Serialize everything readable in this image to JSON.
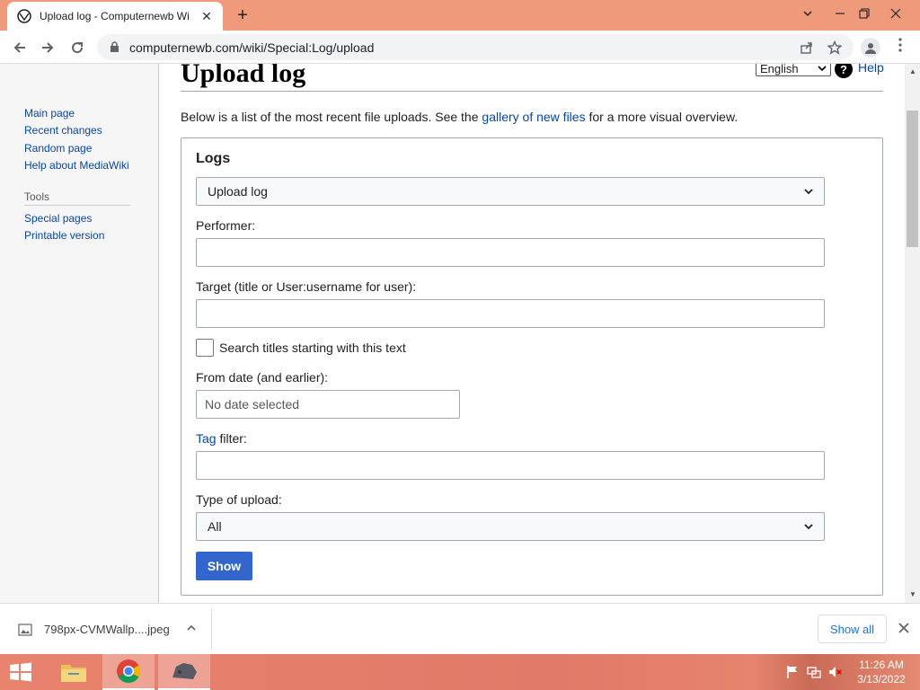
{
  "browser": {
    "tab_title": "Upload log - Computernewb Wi",
    "tab_close": "✕",
    "new_tab": "+",
    "url": "computernewb.com/wiki/Special:Log/upload"
  },
  "sidebar": {
    "nav": [
      {
        "label": "Main page"
      },
      {
        "label": "Recent changes"
      },
      {
        "label": "Random page"
      },
      {
        "label": "Help about MediaWiki"
      }
    ],
    "tools_heading": "Tools",
    "tools": [
      {
        "label": "Special pages"
      },
      {
        "label": "Printable version"
      }
    ]
  },
  "header": {
    "title": "Upload log",
    "language": "English",
    "help_label": "Help",
    "help_icon_glyph": "?"
  },
  "intro": {
    "before": "Below is a list of the most recent file uploads. See the ",
    "link": "gallery of new files",
    "after": " for a more visual overview."
  },
  "form": {
    "legend": "Logs",
    "log_type": "Upload log",
    "performer_label": "Performer:",
    "performer_value": "",
    "target_label": "Target (title or User:username for user):",
    "target_value": "",
    "prefix_search_label": "Search titles starting with this text",
    "prefix_search_checked": false,
    "from_date_label": "From date (and earlier):",
    "from_date_placeholder": "No date selected",
    "tag_link": "Tag",
    "tag_label_rest": " filter:",
    "tag_value": "",
    "upload_type_label": "Type of upload:",
    "upload_type": "All",
    "show_button": "Show"
  },
  "downloads": {
    "file_name": "798px-CVMWallp....jpeg",
    "show_all": "Show all"
  },
  "taskbar": {
    "time": "11:26 AM",
    "date": "3/13/2022"
  },
  "colors": {
    "link": "#0645ad",
    "progressive_button": "#3366cc",
    "tabbar": "#f09a7c",
    "taskbar": "#e17a68"
  }
}
